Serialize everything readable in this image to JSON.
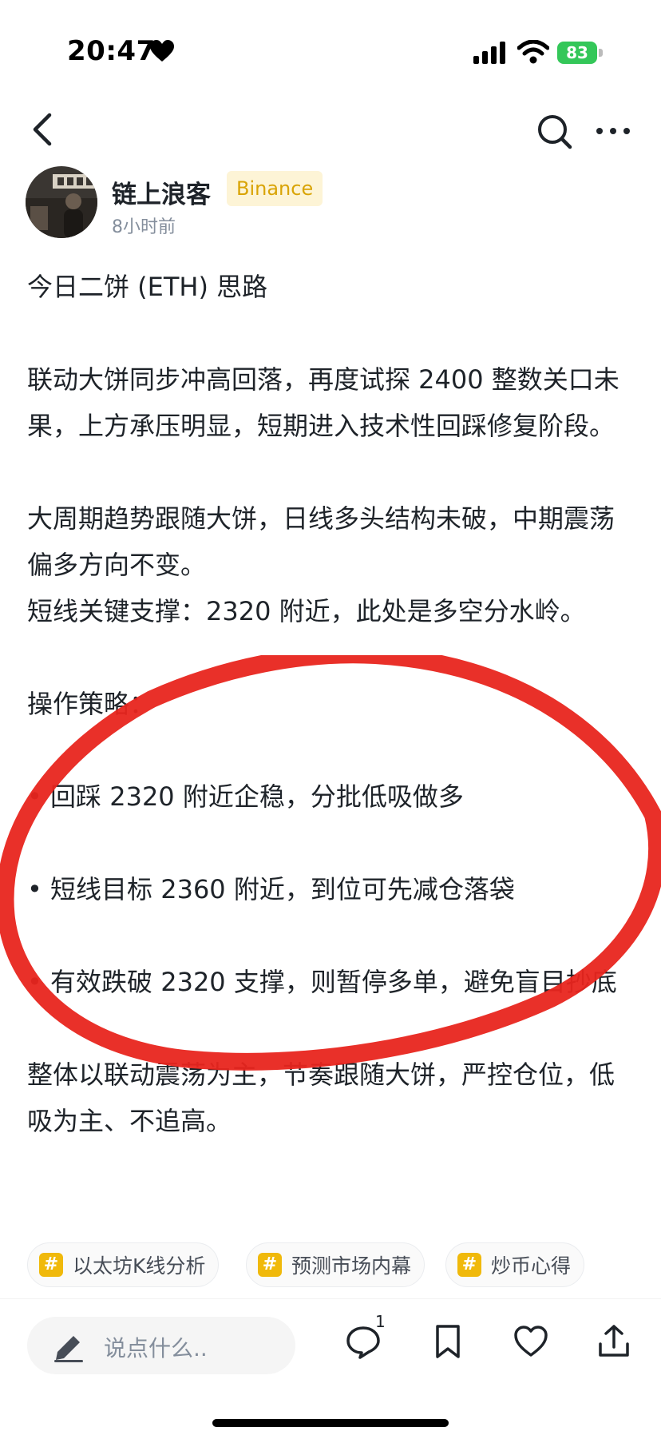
{
  "status_bar": {
    "time": "20:47",
    "battery": "83"
  },
  "author": {
    "name": "链上浪客",
    "badge": "Binance",
    "time_ago": "8小时前"
  },
  "post": {
    "title": "今日二饼 (ETH) 思路",
    "para1": "联动大饼同步冲高回落，再度试探 2400 整数关口未果，上方承压明显，短期进入技术性回踩修复阶段。",
    "para2a": "大周期趋势跟随大饼，日线多头结构未破，中期震荡偏多方向不变。",
    "para2b": "短线关键支撑：2320 附近，此处是多空分水岭。",
    "strategy_heading": "操作策略：",
    "bullets": [
      "• 回踩 2320 附近企稳，分批低吸做多",
      "• 短线目标 2360 附近，到位可先减仓落袋",
      "• 有效跌破 2320 支撑，则暂停多单，避免盲目抄底"
    ],
    "summary": "整体以联动震荡为主，节奏跟随大饼，严控仓位，低吸为主、不追高。"
  },
  "tags": [
    {
      "label": "以太坊K线分析"
    },
    {
      "label": "预测市场内幕"
    },
    {
      "label": "炒币心得"
    }
  ],
  "bottom_bar": {
    "comment_placeholder": "说点什么..",
    "comment_count": "1"
  },
  "colors": {
    "accent": "#f0b90b",
    "badge_bg": "#fdf4d6",
    "scribble": "#e8251d"
  },
  "icons": [
    "heart-icon",
    "signal-icon",
    "wifi-icon",
    "back-icon",
    "search-icon",
    "more-icon",
    "pen-icon",
    "comment-icon",
    "bookmark-icon",
    "like-icon",
    "share-icon"
  ]
}
